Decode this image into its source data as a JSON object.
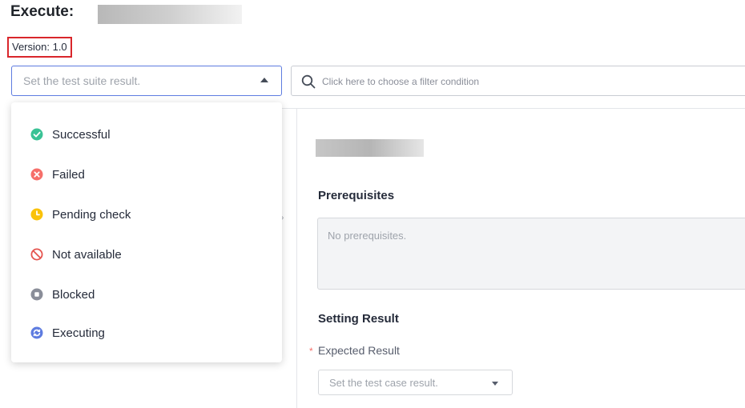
{
  "header": {
    "title": "Execute:",
    "version": "Version: 1.0"
  },
  "suite_select": {
    "placeholder": "Set the test suite result.",
    "icon": "chevron-up-icon"
  },
  "filter": {
    "placeholder": "Click here to choose a filter condition",
    "icon": "search-icon"
  },
  "dropdown": {
    "options": [
      {
        "label": "Successful",
        "icon": "check-circle-icon",
        "color": "#3ac295"
      },
      {
        "label": "Failed",
        "icon": "x-circle-icon",
        "color": "#f66f6a"
      },
      {
        "label": "Pending check",
        "icon": "clock-circle-icon",
        "color": "#fac20a"
      },
      {
        "label": "Not available",
        "icon": "prohibited-icon",
        "color": "#e5544f"
      },
      {
        "label": "Blocked",
        "icon": "stop-circle-icon",
        "color": "#8a8e99"
      },
      {
        "label": "Executing",
        "icon": "refresh-circle-icon",
        "color": "#5e7ce0"
      }
    ]
  },
  "detail": {
    "prerequisites_title": "Prerequisites",
    "prerequisites_text": "No prerequisites.",
    "setting_title": "Setting Result",
    "required_mark": "*",
    "expected_label": "Expected Result",
    "case_select_placeholder": "Set the test case result."
  }
}
